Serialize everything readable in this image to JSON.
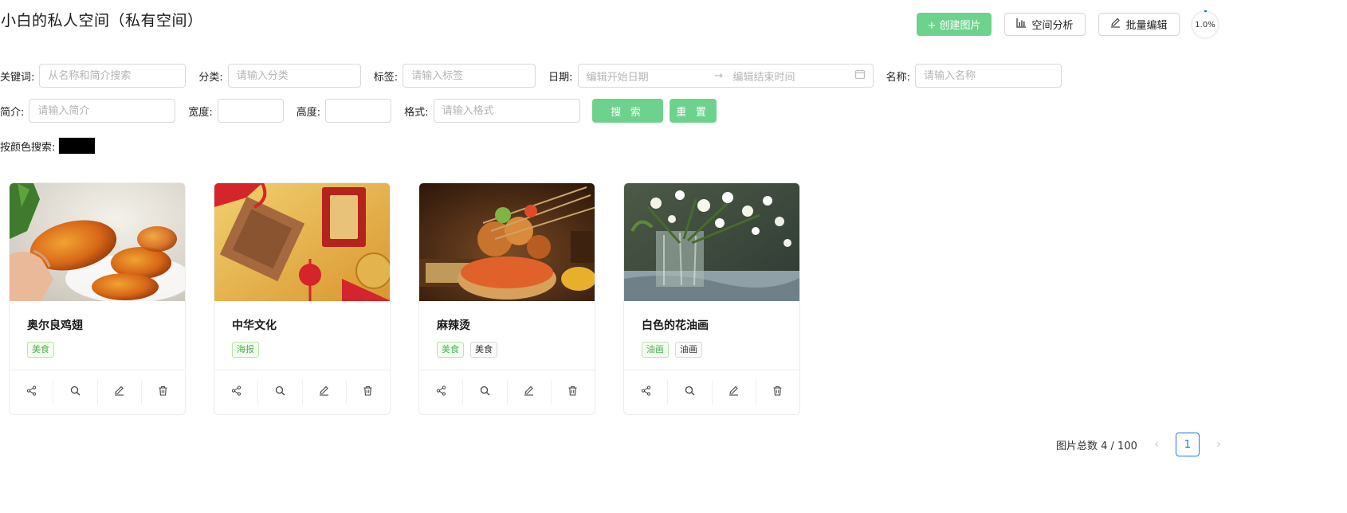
{
  "header": {
    "title": "小白的私人空间（私有空间）",
    "create_label": "+ 创建图片",
    "analyze_label": "空间分析",
    "batch_edit_label": "批量编辑",
    "usage_percent_text": "1.0%",
    "usage_percent": 1.0
  },
  "filters": {
    "keyword": {
      "label": "关键词:",
      "placeholder": "从名称和简介搜索"
    },
    "category": {
      "label": "分类:",
      "placeholder": "请输入分类"
    },
    "tags": {
      "label": "标签:",
      "placeholder": "请输入标签"
    },
    "date": {
      "label": "日期:",
      "start_placeholder": "编辑开始日期",
      "end_placeholder": "编辑结束时间",
      "arrow": "→"
    },
    "name": {
      "label": "名称:",
      "placeholder": "请输入名称"
    },
    "intro": {
      "label": "简介:",
      "placeholder": "请输入简介"
    },
    "width": {
      "label": "宽度:",
      "placeholder": ""
    },
    "height": {
      "label": "高度:",
      "placeholder": ""
    },
    "format": {
      "label": "格式:",
      "placeholder": "请输入格式"
    },
    "search_label": "搜 索",
    "reset_label": "重 置",
    "color": {
      "label": "按颜色搜索:",
      "value": "#000000"
    }
  },
  "pictures": [
    {
      "name": "奥尔良鸡翅",
      "category": "美食",
      "tags": []
    },
    {
      "name": "中华文化",
      "category": "海报",
      "tags": []
    },
    {
      "name": "麻辣烫",
      "category": "美食",
      "tags": [
        "美食"
      ]
    },
    {
      "name": "白色的花油画",
      "category": "油画",
      "tags": [
        "油画"
      ]
    }
  ],
  "pagination": {
    "total_text": "图片总数 4 / 100",
    "current": "1",
    "prev": "‹",
    "next": "›"
  },
  "colors": {
    "primary": "#6dd28d",
    "category_tag": "#4bb14f",
    "page_active": "#1677ff"
  }
}
